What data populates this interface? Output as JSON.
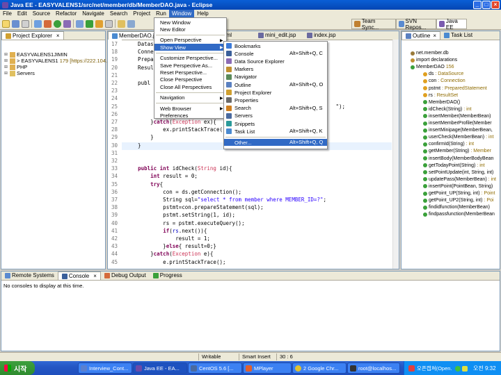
{
  "window": {
    "title": "Java EE - EASYVALENS1/src/net/member/db/MemberDAO.java - Eclipse"
  },
  "menubar": [
    "File",
    "Edit",
    "Source",
    "Refactor",
    "Navigate",
    "Search",
    "Project",
    "Run",
    "Window",
    "Help"
  ],
  "toolbar": {
    "perspectives": [
      "Team Sync...",
      "SVN Repos...",
      "Java EE"
    ]
  },
  "project_explorer": {
    "tab_label": "Project Explorer",
    "items": [
      {
        "label": "EASYVALENS1JIMIN",
        "expanded": false
      },
      {
        "label": "> EASYVALENS1",
        "suffix": "179 [https://222.104.",
        "expanded": false
      },
      {
        "label": "PHP",
        "expanded": false
      },
      {
        "label": "Servers",
        "expanded": false
      }
    ]
  },
  "editor": {
    "tabs": [
      "MemberDAO.java",
      "...x.html",
      "mini_edit.jsp",
      "index.jsp"
    ],
    "line_numbers": [
      "17",
      "18",
      "19",
      "20",
      "21",
      "22",
      "23",
      "24",
      "25",
      "26",
      "27",
      "28",
      "29",
      "30",
      "31",
      "32",
      "33",
      "34",
      "35",
      "36",
      "37",
      "38",
      "39",
      "40",
      "41",
      "42",
      "43",
      "44",
      "45",
      "46",
      "47",
      "48",
      "49"
    ],
    "code_lines": [
      "    Datas",
      "    Conne",
      "    Prepa",
      "    Resul",
      "",
      "    publ",
      "",
      "",
      "                                                                   \");",
      "",
      "        }catch(Exception ex){",
      "            ex.printStackTrace(",
      "        }",
      "    }",
      "",
      "",
      "    public int idCheck(String id){",
      "        int result = 0;",
      "        try{",
      "            con = ds.getConnection();",
      "            String sql=\"select * from member where MEMBER_ID=?\";",
      "            pstmt=con.prepareStatement(sql);",
      "            pstmt.setString(1, id);",
      "            rs = pstmt.executeQuery();",
      "            if(rs.next()){",
      "                result = 1;",
      "            }else{ result=0;}",
      "        }catch(Exception e){",
      "            e.printStackTrace();"
    ]
  },
  "outline": {
    "tabs": [
      "Outline",
      "Task List"
    ],
    "items": [
      {
        "label": "net.member.db",
        "type": ""
      },
      {
        "label": "import declarations",
        "type": ""
      },
      {
        "label": "MemberDAO",
        "type": "156"
      },
      {
        "label": "ds",
        "type": ": DataSource"
      },
      {
        "label": "con",
        "type": ": Connection"
      },
      {
        "label": "pstmt",
        "type": ": PreparedStatement"
      },
      {
        "label": "rs",
        "type": ": ResultSet"
      },
      {
        "label": "MemberDAO()",
        "type": ""
      },
      {
        "label": "idCheck(String)",
        "type": ": int"
      },
      {
        "label": "insertMember(MemberBean)",
        "type": ""
      },
      {
        "label": "insertMemberProfile(Member",
        "type": ""
      },
      {
        "label": "insertMinipage(MemberBean,",
        "type": ""
      },
      {
        "label": "userCheck(MemberBean)",
        "type": ": int"
      },
      {
        "label": "confirmId(String)",
        "type": ": int"
      },
      {
        "label": "getMember(String)",
        "type": ": Member"
      },
      {
        "label": "insertBody(MemberBodyBean",
        "type": ""
      },
      {
        "label": "getTodayPoint(String)",
        "type": ": int"
      },
      {
        "label": "setPointUpdate(int, String, int)",
        "type": ""
      },
      {
        "label": "updatePass(MemberBean)",
        "type": ": int"
      },
      {
        "label": "insertPoint(PointBean, String)",
        "type": ""
      },
      {
        "label": "getPoint_UP(String, int)",
        "type": ": Point"
      },
      {
        "label": "getPoint_UP2(String, int)",
        "type": ": Poi"
      },
      {
        "label": "findidfunction(MemberBean)",
        "type": ""
      },
      {
        "label": "findpassfunction(MemberBean",
        "type": ""
      }
    ]
  },
  "window_menu": {
    "items": [
      {
        "label": "New Window",
        "submenu": false
      },
      {
        "label": "New Editor",
        "submenu": false
      },
      {
        "sep": true
      },
      {
        "label": "Open Perspective",
        "submenu": true
      },
      {
        "label": "Show View",
        "submenu": true,
        "highlighted": true
      },
      {
        "sep": true
      },
      {
        "label": "Customize Perspective...",
        "submenu": false
      },
      {
        "label": "Save Perspective As...",
        "submenu": false
      },
      {
        "label": "Reset Perspective...",
        "submenu": false
      },
      {
        "label": "Close Perspective",
        "submenu": false
      },
      {
        "label": "Close All Perspectives",
        "submenu": false
      },
      {
        "sep": true
      },
      {
        "label": "Navigation",
        "submenu": true
      },
      {
        "sep": true
      },
      {
        "label": "Web Browser",
        "submenu": true
      },
      {
        "label": "Preferences",
        "submenu": false
      }
    ]
  },
  "show_view_menu": {
    "items": [
      {
        "label": "Bookmarks",
        "shortcut": "",
        "icon": "bookmark-icon",
        "color": "#3b7ad8"
      },
      {
        "label": "Console",
        "shortcut": "Alt+Shift+Q, C",
        "icon": "console-icon",
        "color": "#3a5f9a"
      },
      {
        "label": "Data Source Explorer",
        "shortcut": "",
        "icon": "datasource-icon",
        "color": "#8b6bb5"
      },
      {
        "label": "Markers",
        "shortcut": "",
        "icon": "markers-icon",
        "color": "#c09030"
      },
      {
        "label": "Navigator",
        "shortcut": "",
        "icon": "navigator-icon",
        "color": "#5a8a5a"
      },
      {
        "label": "Outline",
        "shortcut": "Alt+Shift+Q, O",
        "icon": "outline-icon",
        "color": "#5a80c0"
      },
      {
        "label": "Project Explorer",
        "shortcut": "",
        "icon": "project-explorer-icon",
        "color": "#d0a030"
      },
      {
        "label": "Properties",
        "shortcut": "",
        "icon": "properties-icon",
        "color": "#6a6a6a"
      },
      {
        "label": "Search",
        "shortcut": "Alt+Shift+Q, S",
        "icon": "search-icon",
        "color": "#d08020"
      },
      {
        "label": "Servers",
        "shortcut": "",
        "icon": "servers-icon",
        "color": "#4a6aa0"
      },
      {
        "label": "Snippets",
        "shortcut": "",
        "icon": "snippets-icon",
        "color": "#2a9a9a"
      },
      {
        "label": "Task List",
        "shortcut": "Alt+Shift+Q, K",
        "icon": "tasklist-icon",
        "color": "#4a8ad0"
      },
      {
        "sep": true
      },
      {
        "label": "Other...",
        "shortcut": "Alt+Shift+Q, Q",
        "highlighted": true
      }
    ]
  },
  "bottom_panel": {
    "tabs": [
      "Remote Systems",
      "Console",
      "Debug Output",
      "Progress"
    ],
    "message": "No consoles to display at this time."
  },
  "statusbar": {
    "writable": "Writable",
    "insert_mode": "Smart Insert",
    "position": "30 : 6"
  },
  "taskbar": {
    "start_label": "시작",
    "tasks": [
      "Interview_Cont...",
      "Java EE - EA...",
      "CentOS 5.6 [...",
      "MPlayer",
      "2 Google Chr...",
      "root@localhos...",
      "오픈캡쳐(Open..."
    ],
    "clock": "오전 9:32"
  }
}
